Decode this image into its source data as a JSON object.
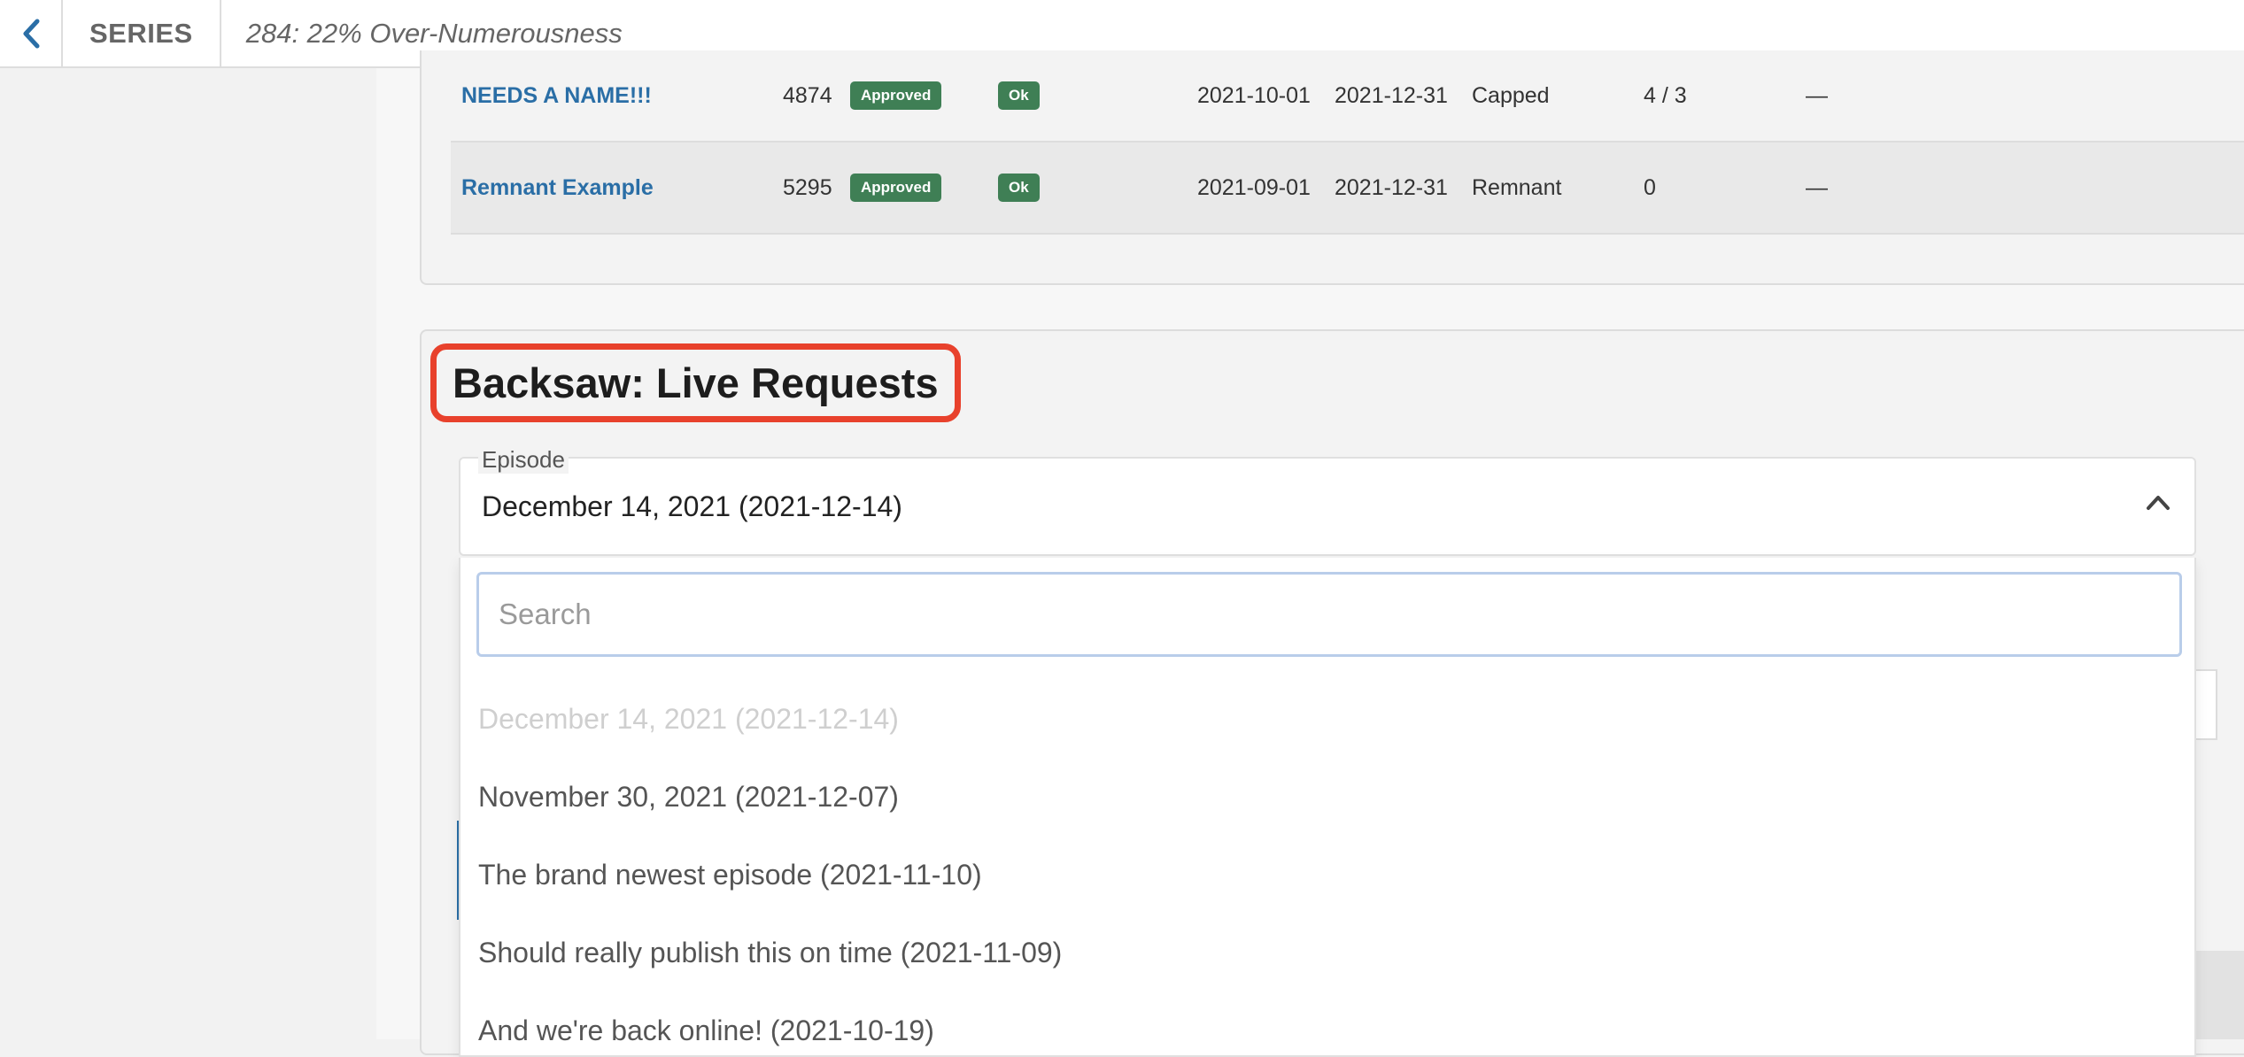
{
  "header": {
    "back_icon": "chevron-left-icon",
    "section": "SERIES",
    "title": "284: 22% Over-Numerousness"
  },
  "table": {
    "rows": [
      {
        "name": "NEEDS A NAME!!!",
        "id": "4874",
        "status": "Approved",
        "check": "Ok",
        "start": "2021-10-01",
        "end": "2021-12-31",
        "type": "Capped",
        "count": "4 / 3",
        "extra": "—"
      },
      {
        "name": "Remnant Example",
        "id": "5295",
        "status": "Approved",
        "check": "Ok",
        "start": "2021-09-01",
        "end": "2021-12-31",
        "type": "Remnant",
        "count": "0",
        "extra": "—"
      }
    ]
  },
  "panel": {
    "heading": "Backsaw: Live Requests",
    "episode_label": "Episode",
    "episode_value": "December 14, 2021 (2021-12-14)",
    "chevron_icon": "chevron-up-icon",
    "search_placeholder": "Search",
    "options": [
      "December 14, 2021 (2021-12-14)",
      "November 30, 2021 (2021-12-07)",
      "The brand newest episode (2021-11-10)",
      "Should really publish this on time (2021-11-09)",
      "And we're back online! (2021-10-19)"
    ]
  },
  "colors": {
    "link": "#2a6ea6",
    "badge": "#3f7f55",
    "highlight": "#e8412c"
  }
}
